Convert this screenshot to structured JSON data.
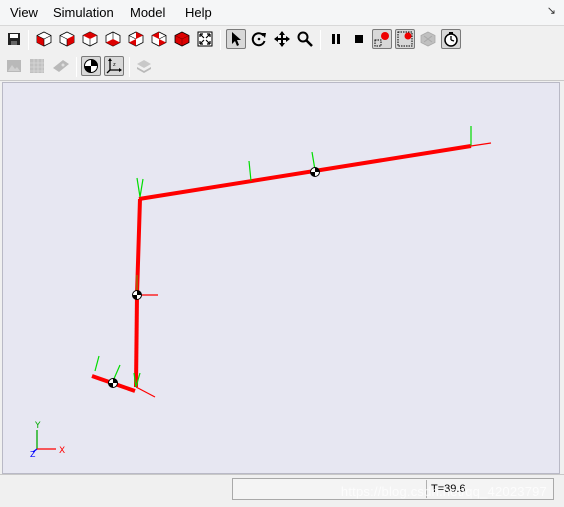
{
  "menubar": {
    "items": [
      "View",
      "Simulation",
      "Model",
      "Help"
    ],
    "mdi_control": "↘"
  },
  "toolbar1": {
    "buttons": [
      {
        "name": "save-icon",
        "state": "normal"
      },
      {
        "name": "view-front-icon",
        "state": "normal"
      },
      {
        "name": "view-back-icon",
        "state": "normal"
      },
      {
        "name": "view-left-icon",
        "state": "normal"
      },
      {
        "name": "view-right-icon",
        "state": "normal"
      },
      {
        "name": "view-top-icon",
        "state": "normal"
      },
      {
        "name": "view-bottom-icon",
        "state": "normal"
      },
      {
        "name": "view-iso-icon",
        "state": "normal"
      },
      {
        "name": "fit-view-icon",
        "state": "normal"
      },
      {
        "name": "select-pointer-icon",
        "state": "pressed"
      },
      {
        "name": "rotate-icon",
        "state": "normal"
      },
      {
        "name": "pan-icon",
        "state": "normal"
      },
      {
        "name": "zoom-icon",
        "state": "normal"
      },
      {
        "name": "pause-icon",
        "state": "normal"
      },
      {
        "name": "stop-icon",
        "state": "normal"
      },
      {
        "name": "record-icon",
        "state": "normal"
      },
      {
        "name": "record-frames-icon",
        "state": "normal"
      },
      {
        "name": "step-disabled-icon",
        "state": "disabled"
      },
      {
        "name": "timer-icon",
        "state": "pressed"
      }
    ]
  },
  "toolbar2": {
    "buttons": [
      {
        "name": "snapshot-icon",
        "state": "disabled"
      },
      {
        "name": "grid-icon",
        "state": "disabled"
      },
      {
        "name": "texture-icon",
        "state": "disabled"
      },
      {
        "name": "center-of-mass-icon",
        "state": "pressed"
      },
      {
        "name": "axes-icon",
        "state": "pressed"
      },
      {
        "name": "layers-icon",
        "state": "disabled"
      }
    ]
  },
  "viewport": {
    "background": "#e7e7f2",
    "link_color": "#ff0000",
    "frame_x_color": "#ff0000",
    "frame_y_color": "#00dd00",
    "axis_labels": {
      "x": "X",
      "y": "Y",
      "z": "Z"
    }
  },
  "status": {
    "time_label": "T=39.6",
    "watermark": "https://blog.csdn.net/qq_42023797"
  }
}
